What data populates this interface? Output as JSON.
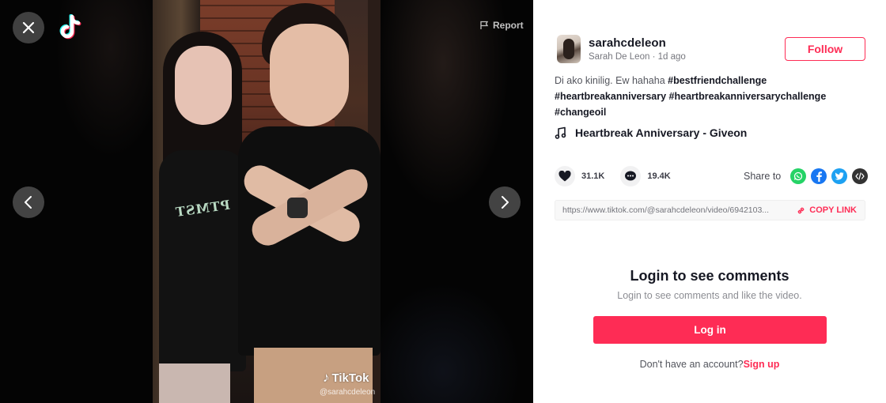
{
  "player": {
    "close_icon": "close-icon",
    "logo_icon": "tiktok-logo-icon",
    "report_label": "Report",
    "prev_icon": "chevron-left-icon",
    "next_icon": "chevron-right-icon",
    "watermark_brand": "TikTok",
    "watermark_user": "@sarahcdeleon"
  },
  "author": {
    "username": "sarahcdeleon",
    "display_name": "Sarah De Leon",
    "separator": " · ",
    "posted": "1d ago",
    "follow_label": "Follow"
  },
  "caption": {
    "text": "Di ako kinilig. Ew hahaha ",
    "hashtags": [
      "#bestfriendchallenge",
      "#heartbreakanniversary",
      "#heartbreakanniversarychallenge",
      "#changeoil"
    ]
  },
  "music": {
    "icon": "music-note-icon",
    "title": "Heartbreak Anniversary - Giveon"
  },
  "stats": {
    "likes": "31.1K",
    "comments": "19.4K"
  },
  "share": {
    "label": "Share to",
    "targets": [
      "whatsapp",
      "facebook",
      "twitter",
      "embed"
    ]
  },
  "link": {
    "url": "https://www.tiktok.com/@sarahcdeleon/video/6942103...",
    "copy_label": "COPY LINK"
  },
  "comments_gate": {
    "title": "Login to see comments",
    "subtitle": "Login to see comments and like the video.",
    "login_label": "Log in",
    "signup_prompt": "Don't have an account?",
    "signup_label": "Sign up"
  },
  "colors": {
    "accent": "#fe2c55",
    "text": "#161823",
    "whatsapp": "#25d366",
    "facebook": "#1877f2",
    "twitter": "#1da1f2",
    "embed": "#333333"
  }
}
